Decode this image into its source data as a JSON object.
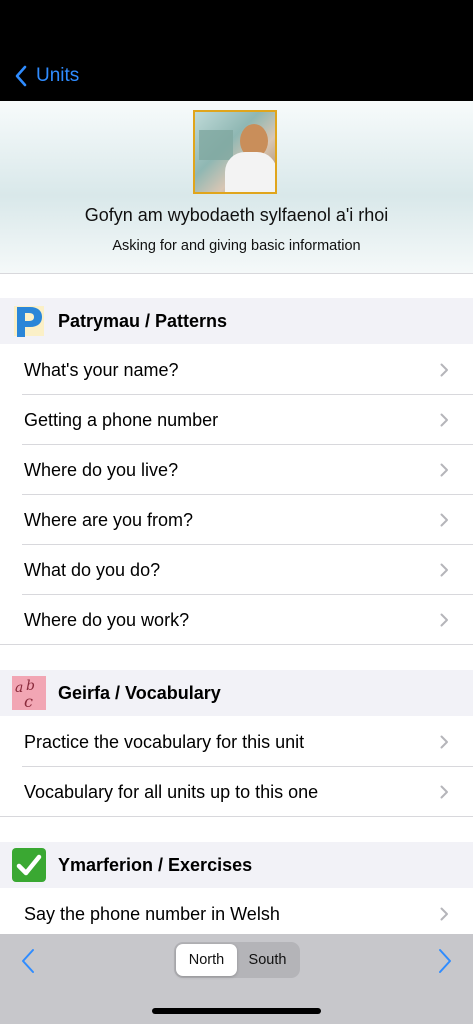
{
  "nav": {
    "back_label": "Units"
  },
  "header": {
    "title": "Gofyn am wybodaeth sylfaenol a'i rhoi",
    "subtitle": "Asking for and giving basic information"
  },
  "sections": [
    {
      "title": "Patrymau / Patterns",
      "icon": "patterns-p-icon",
      "rows": [
        "What's your name?",
        "Getting a phone number",
        "Where do you live?",
        "Where are you from?",
        "What do you do?",
        "Where do you work?"
      ]
    },
    {
      "title": "Geirfa / Vocabulary",
      "icon": "vocabulary-abc-icon",
      "rows": [
        "Practice the vocabulary for this unit",
        "Vocabulary for all units up to this one"
      ]
    },
    {
      "title": "Ymarferion / Exercises",
      "icon": "checkmark-icon",
      "rows": [
        "Say the phone number in Welsh"
      ]
    }
  ],
  "toolbar": {
    "segments": [
      "North",
      "South"
    ],
    "selected": "North"
  },
  "colors": {
    "accent": "#2f8cff",
    "section_bg": "#f2f2f7",
    "toolbar_bg": "#c7c7cb",
    "image_border": "#e0a51c",
    "check_green": "#3aa832"
  }
}
